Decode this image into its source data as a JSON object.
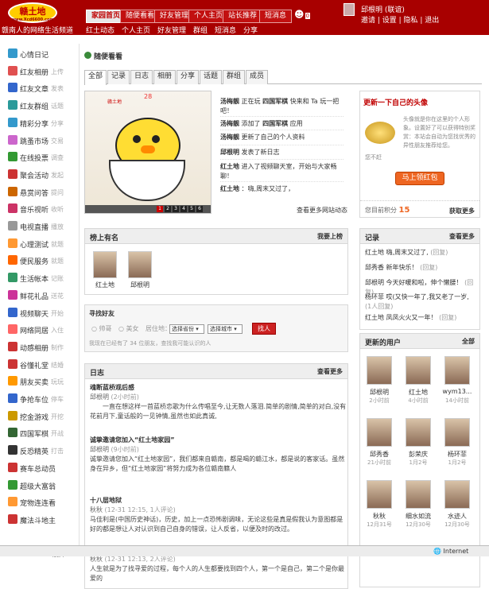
{
  "header": {
    "logo_text": "赣土地",
    "logo_url_text": "www.Xcd6600.com",
    "slogan": "赣南人的网络生活频道",
    "nav_main": [
      "家园首页",
      "随便看看",
      "好友管理",
      "个人主页",
      "站长推荐",
      "短消息"
    ],
    "nav_sub": [
      "红土动态",
      "个人主页",
      "好友管理",
      "群组",
      "短消息",
      "分享"
    ],
    "ghost_label": "0",
    "user": {
      "name": "邱根明",
      "status": "(联谊)",
      "links": "邀请 | 设置 | 隐私 | 退出"
    }
  },
  "sidebar": {
    "items": [
      {
        "label": "心情日记",
        "sub": "",
        "icon_color": "#3399cc",
        "icon": "diary-icon"
      },
      {
        "label": "红友相册",
        "sub": "上传",
        "icon_color": "#e05050",
        "icon": "album-icon"
      },
      {
        "label": "红友文章",
        "sub": "发表",
        "icon_color": "#3366cc",
        "icon": "article-icon"
      },
      {
        "label": "红友群组",
        "sub": "话题",
        "icon_color": "#2a9a9a",
        "icon": "group-icon"
      },
      {
        "label": "精彩分享",
        "sub": "分享",
        "icon_color": "#3399cc",
        "icon": "share-icon"
      },
      {
        "label": "跳蚤市场",
        "sub": "交易",
        "icon_color": "#cc66cc",
        "icon": "market-icon"
      },
      {
        "label": "在线投票",
        "sub": "调查",
        "icon_color": "#339933",
        "icon": "vote-icon"
      },
      {
        "label": "聚会活动",
        "sub": "发起",
        "icon_color": "#cc3333",
        "icon": "event-icon"
      },
      {
        "label": "悬赏问答",
        "sub": "提问",
        "icon_color": "#cc6600",
        "icon": "question-icon"
      },
      {
        "label": "音乐视听",
        "sub": "收听",
        "icon_color": "#cc3366",
        "icon": "music-icon"
      },
      {
        "label": "电视直播",
        "sub": "播放",
        "icon_color": "#999999",
        "icon": "tv-icon"
      },
      {
        "label": "心理测试",
        "sub": "就题",
        "icon_color": "#ff9933",
        "icon": "test-icon"
      },
      {
        "label": "便民服务",
        "sub": "就题",
        "icon_color": "#ff6600",
        "icon": "service-icon"
      },
      {
        "label": "生活帐本",
        "sub": "记账",
        "icon_color": "#339966",
        "icon": "ledger-icon"
      },
      {
        "label": "鲜花礼品",
        "sub": "送花",
        "icon_color": "#cc3399",
        "icon": "flower-icon"
      },
      {
        "label": "视频聊天",
        "sub": "开始",
        "icon_color": "#3366cc",
        "icon": "video-chat-icon"
      },
      {
        "label": "网络同居",
        "sub": "入住",
        "icon_color": "#ff6666",
        "icon": "house-icon"
      },
      {
        "label": "动感相册",
        "sub": "制作",
        "icon_color": "#cc3333",
        "icon": "motion-album-icon"
      },
      {
        "label": "谷懂礼堂",
        "sub": "结婚",
        "icon_color": "#cc3333",
        "icon": "hall-icon"
      },
      {
        "label": "朋友买卖",
        "sub": "玩玩",
        "icon_color": "#ff9900",
        "icon": "trade-icon"
      },
      {
        "label": "争抢车位",
        "sub": "停车",
        "icon_color": "#3366cc",
        "icon": "parking-icon"
      },
      {
        "label": "挖金游戏",
        "sub": "开挖",
        "icon_color": "#cc9900",
        "icon": "gold-icon"
      },
      {
        "label": "四国军棋",
        "sub": "开战",
        "icon_color": "#336633",
        "icon": "chess-icon"
      },
      {
        "label": "反恐精英",
        "sub": "打击",
        "icon_color": "#333333",
        "icon": "cs-icon"
      },
      {
        "label": "赛车总动员",
        "sub": "",
        "icon_color": "#cc3333",
        "icon": "racing-icon"
      },
      {
        "label": "超级大富翁",
        "sub": "",
        "icon_color": "#339933",
        "icon": "monopoly-icon"
      },
      {
        "label": "宠物连连看",
        "sub": "",
        "icon_color": "#ff9933",
        "icon": "pet-icon"
      },
      {
        "label": "魔法斗地主",
        "sub": "",
        "icon_color": "#cc3333",
        "icon": "card-icon"
      }
    ],
    "expand_label": "▾展开"
  },
  "page": {
    "title": "随便看看",
    "tabs": [
      "全部",
      "记录",
      "日志",
      "相册",
      "分享",
      "话题",
      "群组",
      "成员"
    ],
    "image_number": "28",
    "image_mark": "赣土地",
    "image_pages": [
      "1",
      "2",
      "3",
      "4",
      "5",
      "6"
    ],
    "feed": [
      {
        "user": "汤梅靓",
        "text": "正在玩",
        "game": "四国军棋",
        "rest": "快来和 Ta 玩一把吧！"
      },
      {
        "user": "汤梅靓",
        "text": "添加了",
        "game": "四国军棋",
        "rest": "应用"
      },
      {
        "user": "汤梅靓",
        "text": "更新了自己的个人资料",
        "game": "",
        "rest": ""
      },
      {
        "user": "邱根明",
        "text": "发表了新日志",
        "game": "",
        "rest": ""
      },
      {
        "user": "红土地",
        "text": "进入了视频聊天室，开始与大家畅聊！",
        "game": "",
        "rest": ""
      },
      {
        "user": "红土地",
        "text": "：嗨,周末又过了，",
        "game": "",
        "rest": ""
      }
    ],
    "feed_more": "查看更多网站动态"
  },
  "avatar_box": {
    "title": "更新一下自己的头像",
    "text": "头像就是你在这里的个人形象。设置好了可以获得特别奖赏：本站会自动为您找优秀的异性朋友推荐给您。",
    "close": "您不赶",
    "button": "马上领红包",
    "points_label": "您目前积分",
    "points": "15",
    "more": "获取更多"
  },
  "ranking": {
    "title": "榜上有名",
    "more": "我要上榜",
    "users": [
      "红土地",
      "邱根明"
    ]
  },
  "find_friend": {
    "title": "寻找好友",
    "options": [
      "帅哥",
      "美女"
    ],
    "city_label": "居住地：",
    "province": "选择省份",
    "city": "选择城市",
    "button": "找人",
    "note": "我现在已经有了 34 位朋友，查找我可能认识的人"
  },
  "records": {
    "title": "记录",
    "more": "查看更多",
    "items": [
      {
        "user": "红土地",
        "text": "嗨,周末又过了,",
        "time": "(回复)"
      },
      {
        "user": "邱秀香",
        "text": "新年快乐！",
        "time": "(回复)"
      },
      {
        "user": "邱根明",
        "text": "今天好暖和啦，伸个懒腰！",
        "time": "(回复)"
      },
      {
        "user": "杨环菲",
        "text": "哎(又快一年了,我又老了一岁,",
        "time": "(1人回复)"
      },
      {
        "user": "红土地",
        "text": "凤凤火火又一年！",
        "time": "(回复)"
      }
    ]
  },
  "diary": {
    "title": "日志",
    "more": "查看更多",
    "entries": [
      {
        "title": "魂断蓝桥观后感",
        "author": "邱根明",
        "time": "(2小时前)",
        "body": "一直在想这样一首蓝桥恋歌为什么传唱至今,让无数人落泪.简单的剧情,简单的对白,没有花前月下,童话般的一见钟情,虽然也如此真诚,"
      },
      {
        "title": "诚挚邀请您加入“红土地家园”",
        "author": "邱根明",
        "time": "(9小时前)",
        "body": "诚挚邀请您加入“红土地家园”，我们都来自赣南，都是喝的赣江水，都是说的客家话。虽然身在异乡，但“红土地家园”将努力成为各位赣南籍人"
      },
      {
        "title": "十八层地狱",
        "author": "秋秋",
        "time": "(12-31 12:15, 1人评论)",
        "body": "马佳利是(中国历史神话)，历史，加上一点恐怖剧调味，无论这些是真是假我认为意图都是好的都是想让人对认识到自己自身的错误，让人反省，以便及时的改过。"
      },
      {
        "title": "人的一生会遇上的四个人",
        "author": "秋秋",
        "time": "(12-31 12:13, 2人评论)",
        "body": "人生就是为了找寻爱的过程，每个人的人生都要找到四个人，第一个是自己，第二个是你最爱的"
      }
    ]
  },
  "updated_users": {
    "title": "更新的用户",
    "more": "全部",
    "users": [
      {
        "name": "邱根明",
        "time": "2小时前"
      },
      {
        "name": "红土地",
        "time": "4小时前"
      },
      {
        "name": "wym13...",
        "time": "14小时前"
      },
      {
        "name": "邱秀香",
        "time": "21小时前"
      },
      {
        "name": "彭荣庆",
        "time": "1月2号"
      },
      {
        "name": "杨环菲",
        "time": "1月2号"
      },
      {
        "name": "秋秋",
        "time": "12月31号"
      },
      {
        "name": "细水如流",
        "time": "12月30号"
      },
      {
        "name": "水迹人",
        "time": "12月30号"
      }
    ]
  },
  "status_bar": {
    "zone": "Internet"
  }
}
